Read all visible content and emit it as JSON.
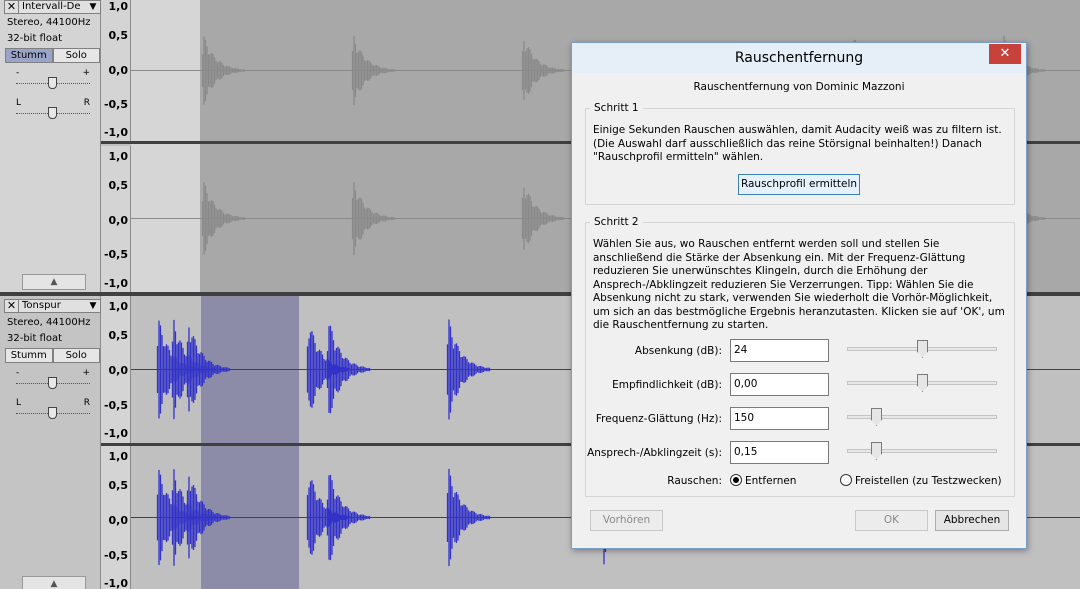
{
  "tracks": [
    {
      "name": "Intervall-De",
      "format": "Stereo, 44100Hz",
      "bitdepth": "32-bit float",
      "mute_label": "Stumm",
      "solo_label": "Solo",
      "gain_minus": "-",
      "gain_plus": "+",
      "pan_left": "L",
      "pan_right": "R",
      "ticks": [
        "1,0",
        "0,5",
        "0,0",
        "-0,5",
        "-1,0"
      ]
    },
    {
      "name": "Tonspur",
      "format": "Stereo, 44100Hz",
      "bitdepth": "32-bit float",
      "mute_label": "Stumm",
      "solo_label": "Solo",
      "gain_minus": "-",
      "gain_plus": "+",
      "pan_left": "L",
      "pan_right": "R",
      "ticks": [
        "1,0",
        "0,5",
        "0,0",
        "-0,5",
        "-1,0"
      ]
    }
  ],
  "icons": {
    "close": "close-icon",
    "dropdown": "dropdown-icon",
    "collapse": "collapse-icon"
  },
  "colors": {
    "waveform_gray": "#8a8a8a",
    "waveform_blue": "#3232c8",
    "selection": "#8c8ca8",
    "selected_track_bg": "#c0c0c0"
  },
  "dialog": {
    "title": "Rauschentfernung",
    "subtitle": "Rauschentfernung von Dominic Mazzoni",
    "step1": {
      "legend": "Schritt 1",
      "text": "Einige Sekunden Rauschen auswählen, damit Audacity weiß was zu filtern ist. (Die Auswahl darf ausschließlich das reine Störsignal beinhalten!) Danach \"Rauschprofil ermitteln\" wählen.",
      "button": "Rauschprofil ermitteln"
    },
    "step2": {
      "legend": "Schritt 2",
      "text": "Wählen Sie aus, wo Rauschen entfernt werden soll und stellen Sie anschließend die Stärke der Absenkung ein. Mit der Frequenz-Glättung reduzieren Sie unerwünschtes Klingeln, durch die Erhöhung der Ansprech-/Abklingzeit reduzieren Sie Verzerrungen. Tipp: Wählen Sie die Absenkung nicht zu stark, verwenden Sie wiederholt die Vorhör-Möglichkeit, um sich an das bestmögliche Ergebnis heranzutasten. Klicken sie auf 'OK', um die Rauschentfernung zu starten.",
      "fields": [
        {
          "label": "Absenkung (dB):",
          "value": "24",
          "level": 0.5
        },
        {
          "label": "Empfindlichkeit (dB):",
          "value": "0,00",
          "level": 0.5
        },
        {
          "label": "Frequenz-Glättung (Hz):",
          "value": "150",
          "level": 0.17
        },
        {
          "label": "Ansprech-/Abklingzeit (s):",
          "value": "0,15",
          "level": 0.17
        }
      ],
      "noise_label": "Rauschen:",
      "radio_remove": "Entfernen",
      "radio_isolate": "Freistellen (zu Testzwecken)",
      "selected_radio": "Entfernen"
    },
    "buttons": {
      "preview": "Vorhören",
      "ok": "OK",
      "cancel": "Abbrechen"
    }
  }
}
